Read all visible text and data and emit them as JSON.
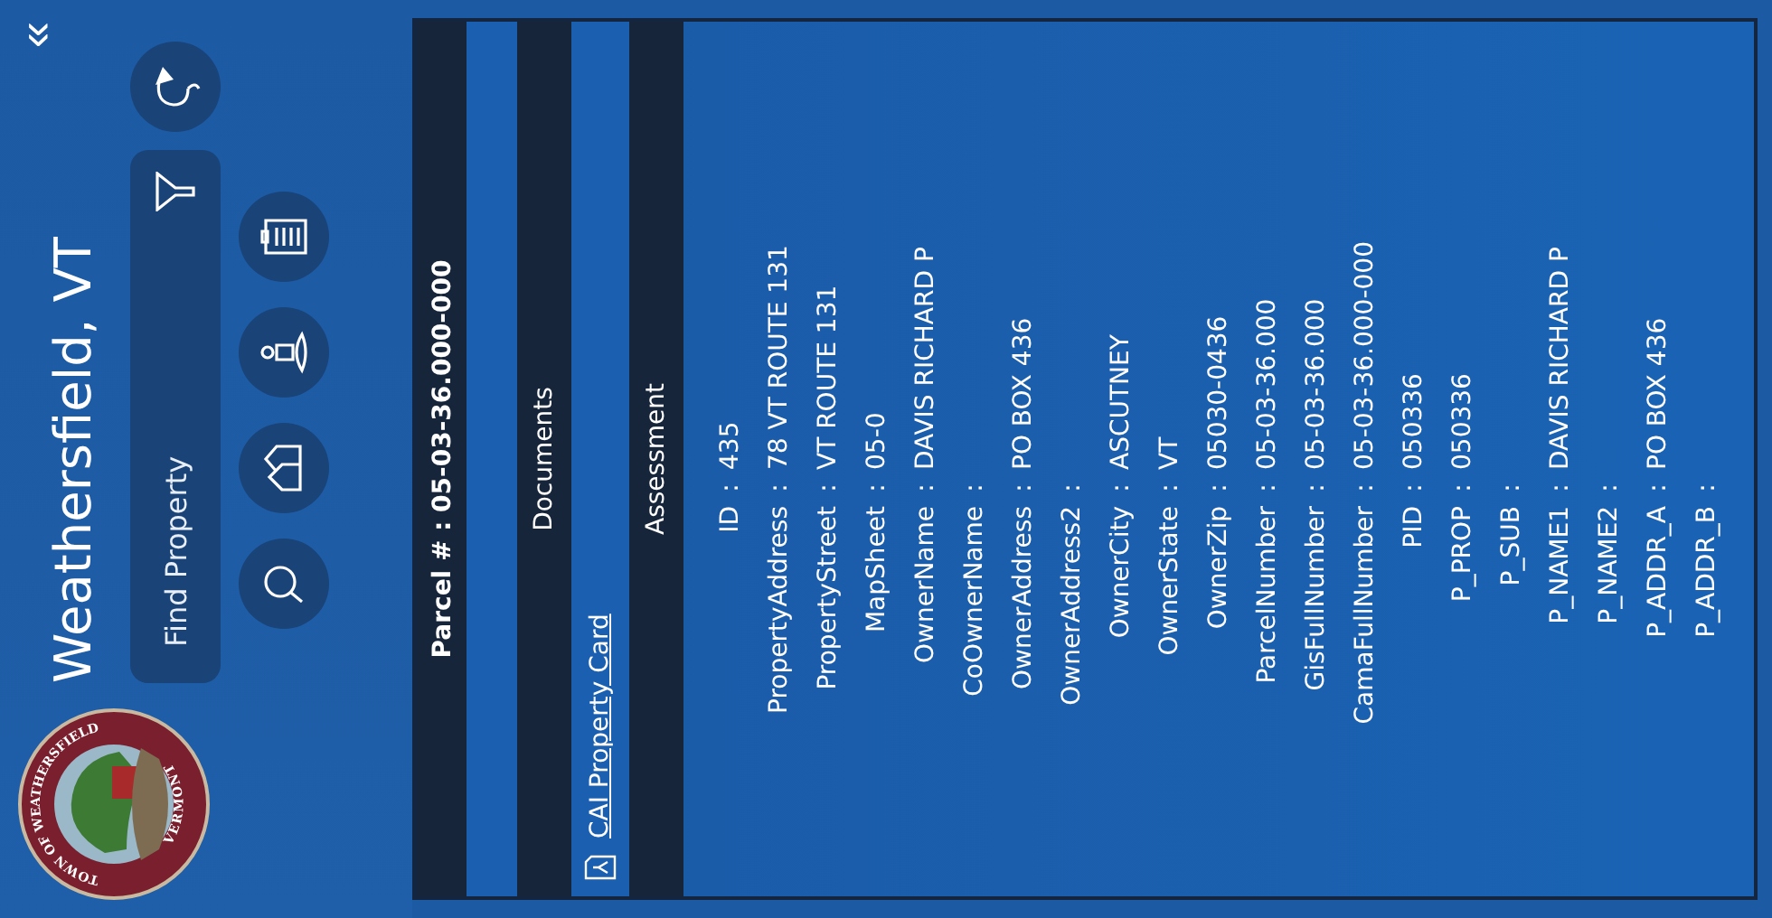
{
  "header": {
    "logo_text": [
      "TOWN OF WEATHERSFIELD",
      "VERMONT"
    ],
    "title": "Weathersfield, VT",
    "collapse": "«",
    "search": {
      "placeholder": "Find Property"
    }
  },
  "sections": [
    {
      "kind": "heading",
      "label": "Parcel # : 05-03-36.000-000"
    },
    {
      "kind": "band"
    },
    {
      "kind": "heading",
      "label": "Documents"
    },
    {
      "kind": "link",
      "label": "CAI Property Card"
    },
    {
      "kind": "heading",
      "label": "Assessment"
    }
  ],
  "attributes": [
    {
      "key": "ID",
      "separator": ":",
      "value": "435"
    },
    {
      "key": "PropertyAddress",
      "separator": ":",
      "value": "78 VT ROUTE 131"
    },
    {
      "key": "PropertyStreet",
      "separator": ":",
      "value": "VT ROUTE 131"
    },
    {
      "key": "MapSheet",
      "separator": ":",
      "value": "05-0"
    },
    {
      "key": "OwnerName",
      "separator": ":",
      "value": "DAVIS RICHARD P"
    },
    {
      "key": "CoOwnerName",
      "separator": ":"
    },
    {
      "key": "OwnerAddress",
      "separator": ":",
      "value": "PO BOX 436"
    },
    {
      "key": "OwnerAddress2",
      "separator": ":"
    },
    {
      "key": "OwnerCity",
      "separator": ":",
      "value": "ASCUTNEY"
    },
    {
      "key": "OwnerState",
      "separator": ":",
      "value": "VT"
    },
    {
      "key": "OwnerZip",
      "separator": ":",
      "value": "05030-0436"
    },
    {
      "key": "ParcelNumber",
      "separator": ":",
      "value": "05-03-36.000"
    },
    {
      "key": "GisFullNumber",
      "separator": ":",
      "value": "05-03-36.000"
    },
    {
      "key": "CamaFullNumber",
      "separator": ":",
      "value": "05-03-36.000-000"
    },
    {
      "key": "PID",
      "separator": ":",
      "value": "050336"
    },
    {
      "key": "P_PROP",
      "separator": ":",
      "value": "050336"
    },
    {
      "key": "P_SUB",
      "separator": ":"
    },
    {
      "key": "P_NAME1",
      "separator": ":",
      "value": "DAVIS RICHARD P"
    },
    {
      "key": "P_NAME2",
      "separator": ":"
    },
    {
      "key": "P_ADDR_A",
      "separator": ":",
      "value": "PO BOX 436"
    },
    {
      "key": "P_ADDR_B",
      "separator": ":"
    }
  ]
}
